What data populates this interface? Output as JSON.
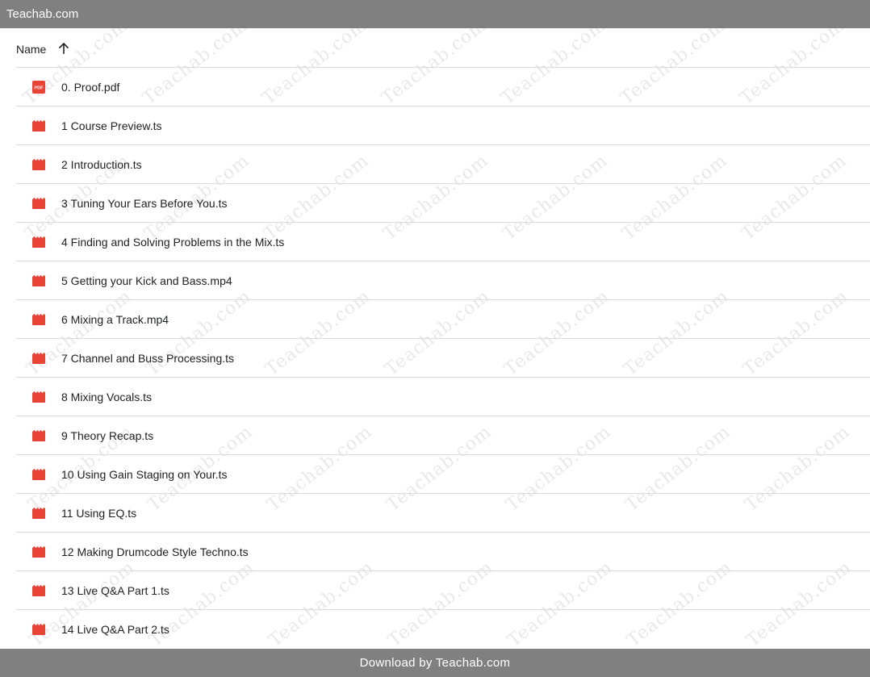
{
  "topbar": {
    "title": "Teachab.com"
  },
  "list_header": {
    "name_label": "Name",
    "sort_icon": "arrow-up-icon"
  },
  "files": [
    {
      "name": "0. Proof.pdf",
      "icon": "pdf-file-icon"
    },
    {
      "name": "1 Course Preview.ts",
      "icon": "video-file-icon"
    },
    {
      "name": "2 Introduction.ts",
      "icon": "video-file-icon"
    },
    {
      "name": "3 Tuning Your Ears Before You.ts",
      "icon": "video-file-icon"
    },
    {
      "name": "4 Finding and Solving Problems in the Mix.ts",
      "icon": "video-file-icon"
    },
    {
      "name": "5 Getting your Kick and Bass.mp4",
      "icon": "video-file-icon"
    },
    {
      "name": "6 Mixing a Track.mp4",
      "icon": "video-file-icon"
    },
    {
      "name": "7 Channel and Buss Processing.ts",
      "icon": "video-file-icon"
    },
    {
      "name": "8 Mixing Vocals.ts",
      "icon": "video-file-icon"
    },
    {
      "name": "9 Theory Recap.ts",
      "icon": "video-file-icon"
    },
    {
      "name": "10 Using Gain Staging on Your.ts",
      "icon": "video-file-icon"
    },
    {
      "name": "11 Using EQ.ts",
      "icon": "video-file-icon"
    },
    {
      "name": "12 Making Drumcode Style Techno.ts",
      "icon": "video-file-icon"
    },
    {
      "name": "13 Live Q&A Part 1.ts",
      "icon": "video-file-icon"
    },
    {
      "name": "14 Live Q&A Part 2.ts",
      "icon": "video-file-icon"
    }
  ],
  "watermark": {
    "text": "Teachab.com"
  },
  "footer": {
    "text": "Download by Teachab.com"
  },
  "colors": {
    "bar": "#808080",
    "icon_red": "#ea4335",
    "divider": "#dadce0"
  }
}
